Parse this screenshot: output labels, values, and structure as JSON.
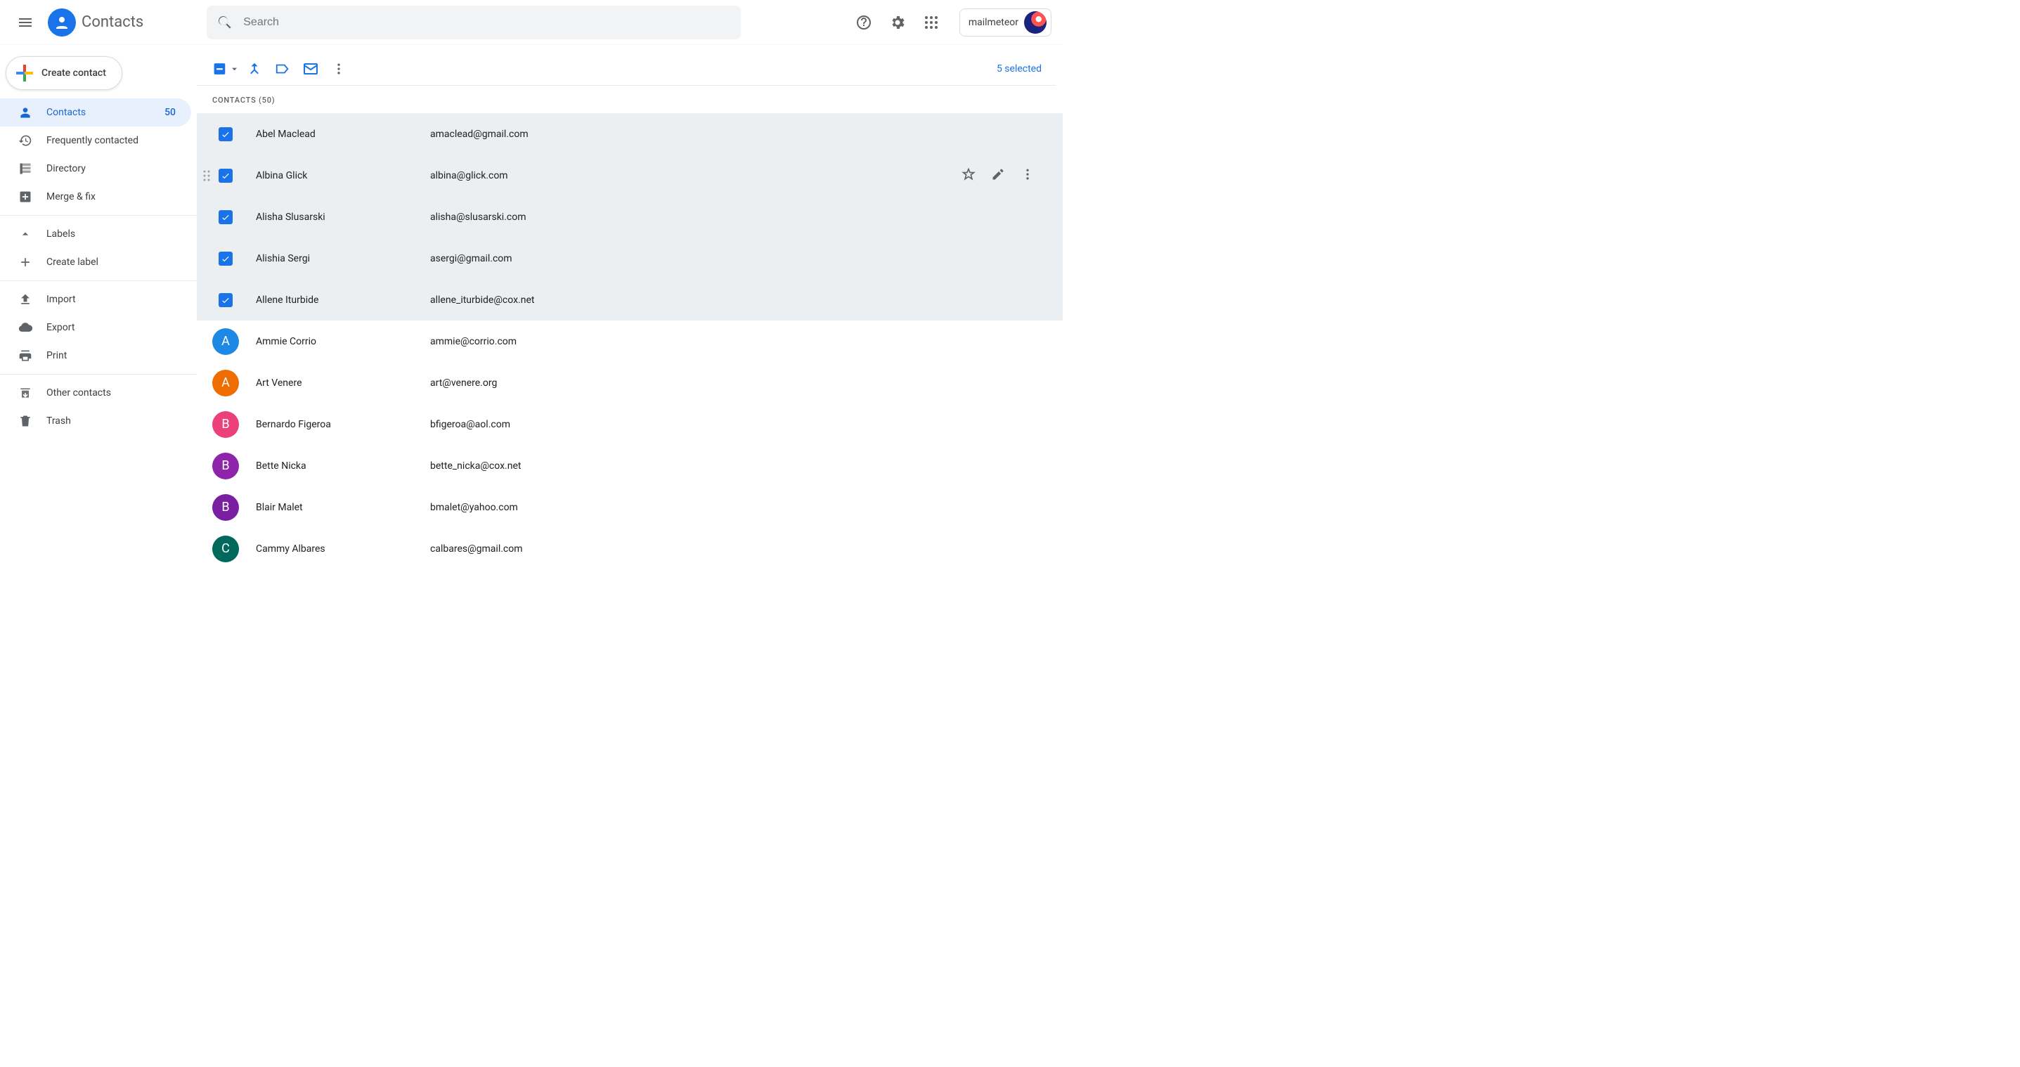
{
  "header": {
    "app_title": "Contacts",
    "search_placeholder": "Search",
    "account_label": "mailmeteor"
  },
  "sidebar": {
    "create_label": "Create contact",
    "items": [
      {
        "label": "Contacts",
        "count": "50"
      },
      {
        "label": "Frequently contacted"
      },
      {
        "label": "Directory"
      },
      {
        "label": "Merge & fix"
      }
    ],
    "labels_header": "Labels",
    "create_label_text": "Create label",
    "import_label": "Import",
    "export_label": "Export",
    "print_label": "Print",
    "other_label": "Other contacts",
    "trash_label": "Trash"
  },
  "toolbar": {
    "selected_text": "5 selected"
  },
  "section": {
    "label": "Contacts (50)"
  },
  "contacts": [
    {
      "name": "Abel Maclead",
      "email": "amaclead@gmail.com",
      "selected": true
    },
    {
      "name": "Albina Glick",
      "email": "albina@glick.com",
      "selected": true,
      "hovered": true
    },
    {
      "name": "Alisha Slusarski",
      "email": "alisha@slusarski.com",
      "selected": true
    },
    {
      "name": "Alishia Sergi",
      "email": "asergi@gmail.com",
      "selected": true
    },
    {
      "name": "Allene Iturbide",
      "email": "allene_iturbide@cox.net",
      "selected": true
    },
    {
      "name": "Ammie Corrio",
      "email": "ammie@corrio.com",
      "selected": false,
      "avatar_bg": "#1e88e5",
      "avatar_letter": "A"
    },
    {
      "name": "Art Venere",
      "email": "art@venere.org",
      "selected": false,
      "avatar_bg": "#ef6c00",
      "avatar_letter": "A"
    },
    {
      "name": "Bernardo Figeroa",
      "email": "bfigeroa@aol.com",
      "selected": false,
      "avatar_bg": "#ec407a",
      "avatar_letter": "B"
    },
    {
      "name": "Bette Nicka",
      "email": "bette_nicka@cox.net",
      "selected": false,
      "avatar_bg": "#8e24aa",
      "avatar_letter": "B"
    },
    {
      "name": "Blair Malet",
      "email": "bmalet@yahoo.com",
      "selected": false,
      "avatar_bg": "#7b1fa2",
      "avatar_letter": "B"
    },
    {
      "name": "Cammy Albares",
      "email": "calbares@gmail.com",
      "selected": false,
      "avatar_bg": "#00695c",
      "avatar_letter": "C"
    }
  ]
}
